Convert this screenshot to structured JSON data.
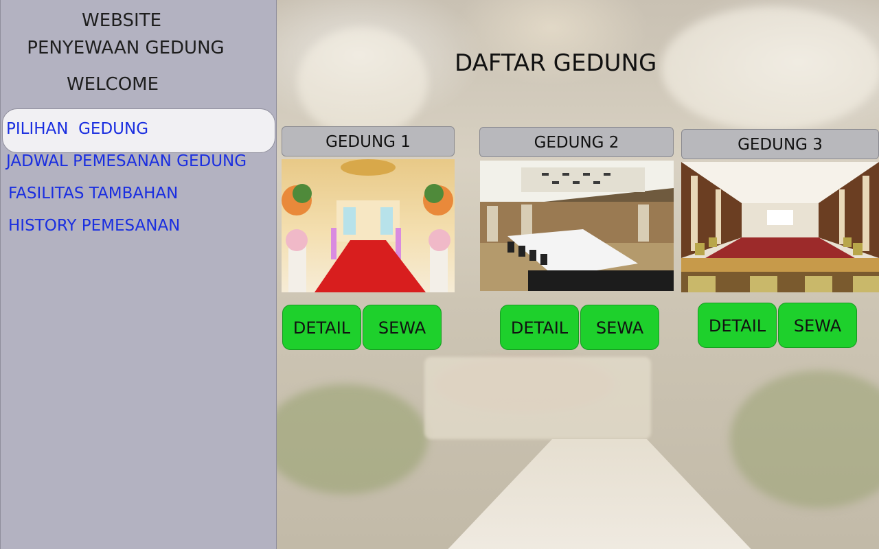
{
  "sidebar": {
    "title_line1": "WEBSITE",
    "title_line2": "PENYEWAAN GEDUNG",
    "welcome": "WELCOME",
    "items": [
      {
        "label": "PILIHAN  GEDUNG",
        "active": true
      },
      {
        "label": "JADWAL PEMESANAN GEDUNG",
        "active": false
      },
      {
        "label": "FASILITAS TAMBAHAN",
        "active": false
      },
      {
        "label": "HISTORY PEMESANAN",
        "active": false
      }
    ]
  },
  "main": {
    "title": "DAFTAR GEDUNG",
    "cards": [
      {
        "name": "GEDUNG 1",
        "detail_label": "DETAIL",
        "rent_label": "SEWA"
      },
      {
        "name": "GEDUNG 2",
        "detail_label": "DETAIL",
        "rent_label": "SEWA"
      },
      {
        "name": "GEDUNG 3",
        "detail_label": "DETAIL",
        "rent_label": "SEWA"
      }
    ]
  },
  "colors": {
    "sidebar_bg": "#b3b2c1",
    "nav_link": "#1a2ee0",
    "button_green": "#1ed02c",
    "label_gray": "#b8b8bc"
  }
}
